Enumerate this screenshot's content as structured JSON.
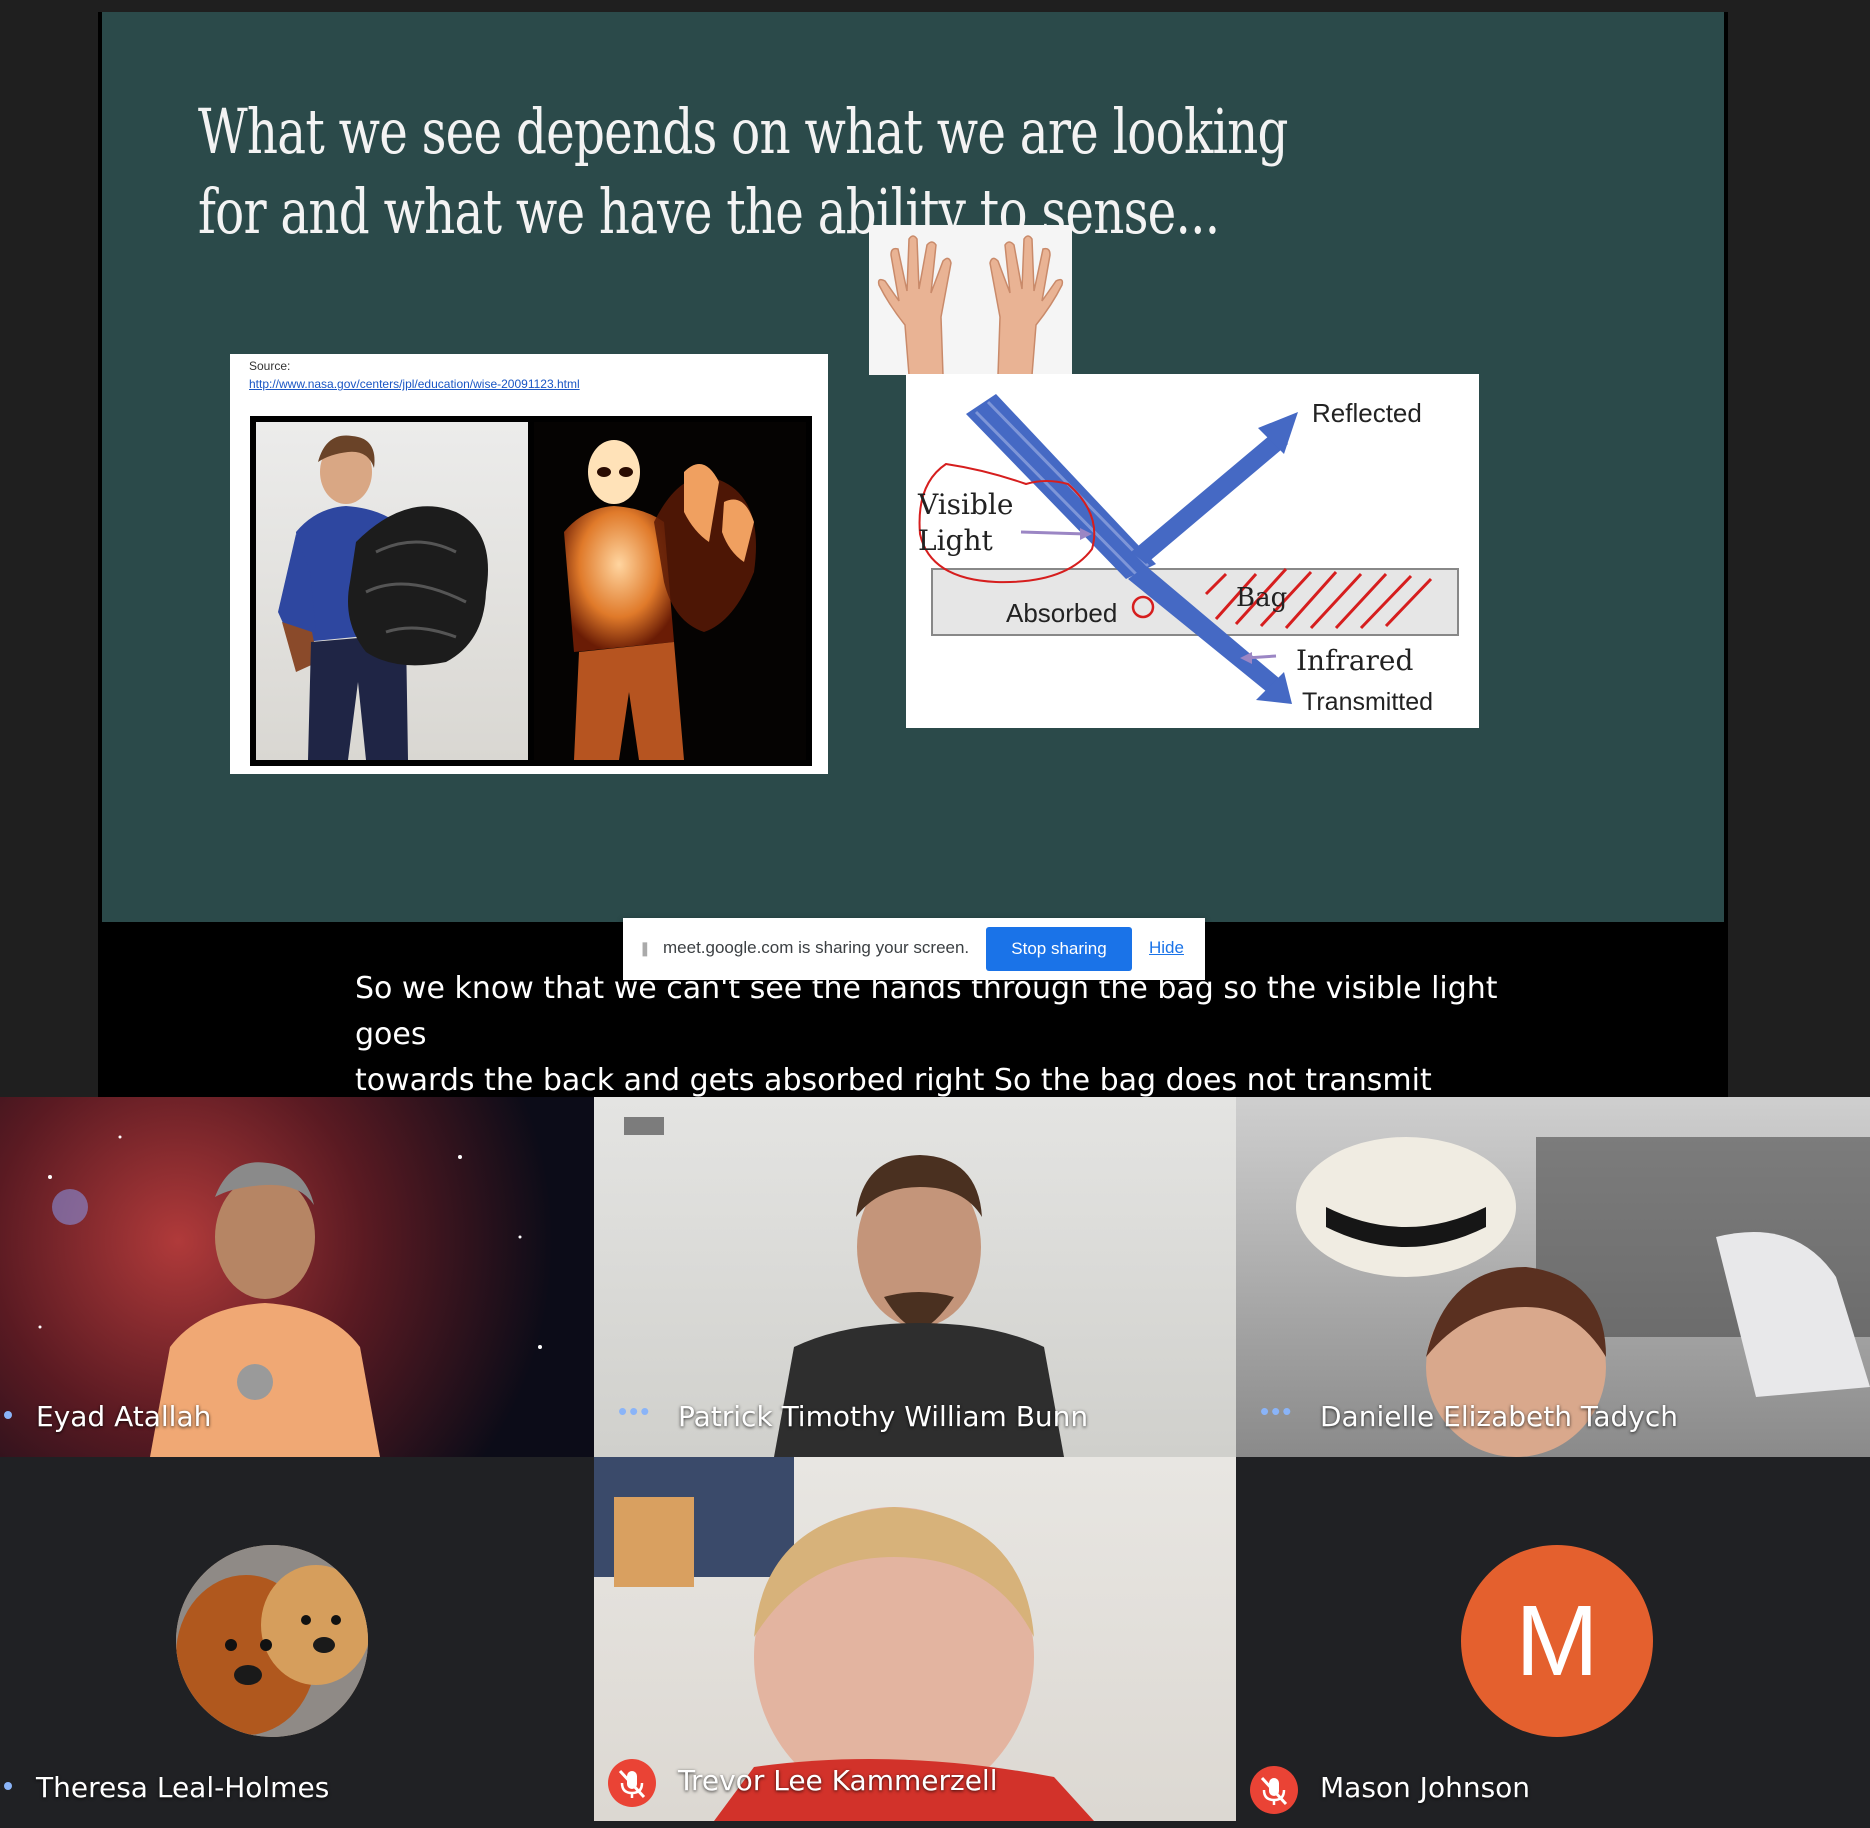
{
  "slide": {
    "title": "What we see depends on what we are looking for and what we have the ability to sense...",
    "source_label": "Source:",
    "source_link": "http://www.nasa.gov/centers/jpl/education/wise-20091123.html",
    "diagram": {
      "reflected": "Reflected",
      "visible_1": "Visible",
      "visible_2": "Light",
      "absorbed": "Absorbed",
      "bag": "Bag",
      "infrared": "Infrared",
      "transmitted": "Transmitted"
    }
  },
  "share_bar": {
    "message": "meet.google.com is sharing your screen.",
    "stop_label": "Stop sharing",
    "hide_label": "Hide"
  },
  "captions": {
    "line1": "So we know that we can't see the hands through the bag so the visible light goes",
    "line2": "towards the back and gets absorbed right So the bag does not transmit"
  },
  "participants": [
    {
      "name": "Eyad Atallah"
    },
    {
      "name": "Patrick Timothy William Bunn"
    },
    {
      "name": "Danielle Elizabeth Tadych"
    },
    {
      "name": "Theresa Leal-Holmes"
    },
    {
      "name": "Trevor Lee Kammerzell"
    },
    {
      "name": "Mason Johnson",
      "avatar_letter": "M",
      "avatar_color": "#e4602e"
    }
  ],
  "colors": {
    "slide_bg": "#2b4a4a",
    "primary_blue": "#1a73e8",
    "diagram_arrow": "#4569c4",
    "annotation_red": "#d61e1e",
    "mic_off_red": "#ea4335"
  }
}
